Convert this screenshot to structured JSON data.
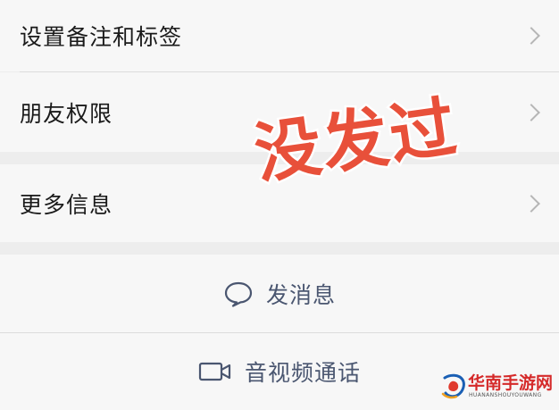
{
  "menu": {
    "items": [
      {
        "label": "设置备注和标签"
      },
      {
        "label": "朋友权限"
      },
      {
        "label": "更多信息"
      }
    ]
  },
  "actions": {
    "message_label": "发消息",
    "video_call_label": "音视频通话"
  },
  "overlay": {
    "stamp_text": "没发过",
    "stamp_color": "#e8503a"
  },
  "watermark": {
    "title": "华南手游网",
    "subtitle": "HUANANSHOUYOUWANG"
  },
  "icons": {
    "chevron": "chevron-right-icon",
    "message": "chat-bubble-icon",
    "video": "video-camera-icon"
  },
  "colors": {
    "background": "#ededed",
    "cell": "#f7f7f7",
    "action_text": "#4a5670",
    "watermark_red": "#d52a2a"
  }
}
